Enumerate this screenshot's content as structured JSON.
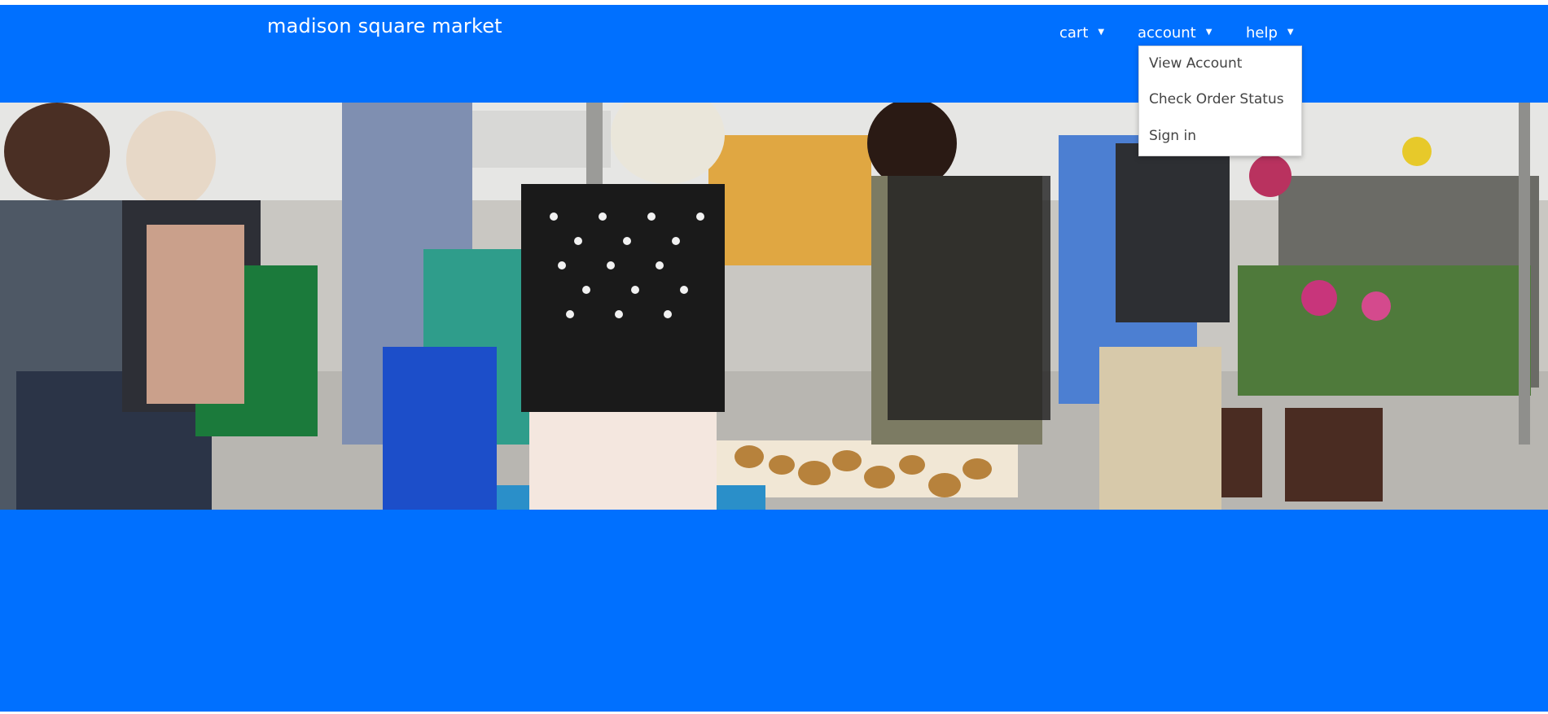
{
  "header": {
    "brand": "madison square market"
  },
  "nav": {
    "cart_label": "cart",
    "account_label": "account",
    "help_label": "help",
    "caret_icon": "caret-down-icon"
  },
  "account_menu": {
    "items": [
      {
        "label": "View Account"
      },
      {
        "label": "Check Order Status"
      },
      {
        "label": "Sign in"
      }
    ]
  },
  "colors": {
    "page_background": "#0070ff",
    "menu_background": "#ffffff",
    "menu_text": "#444444",
    "nav_text": "#ffffff"
  }
}
